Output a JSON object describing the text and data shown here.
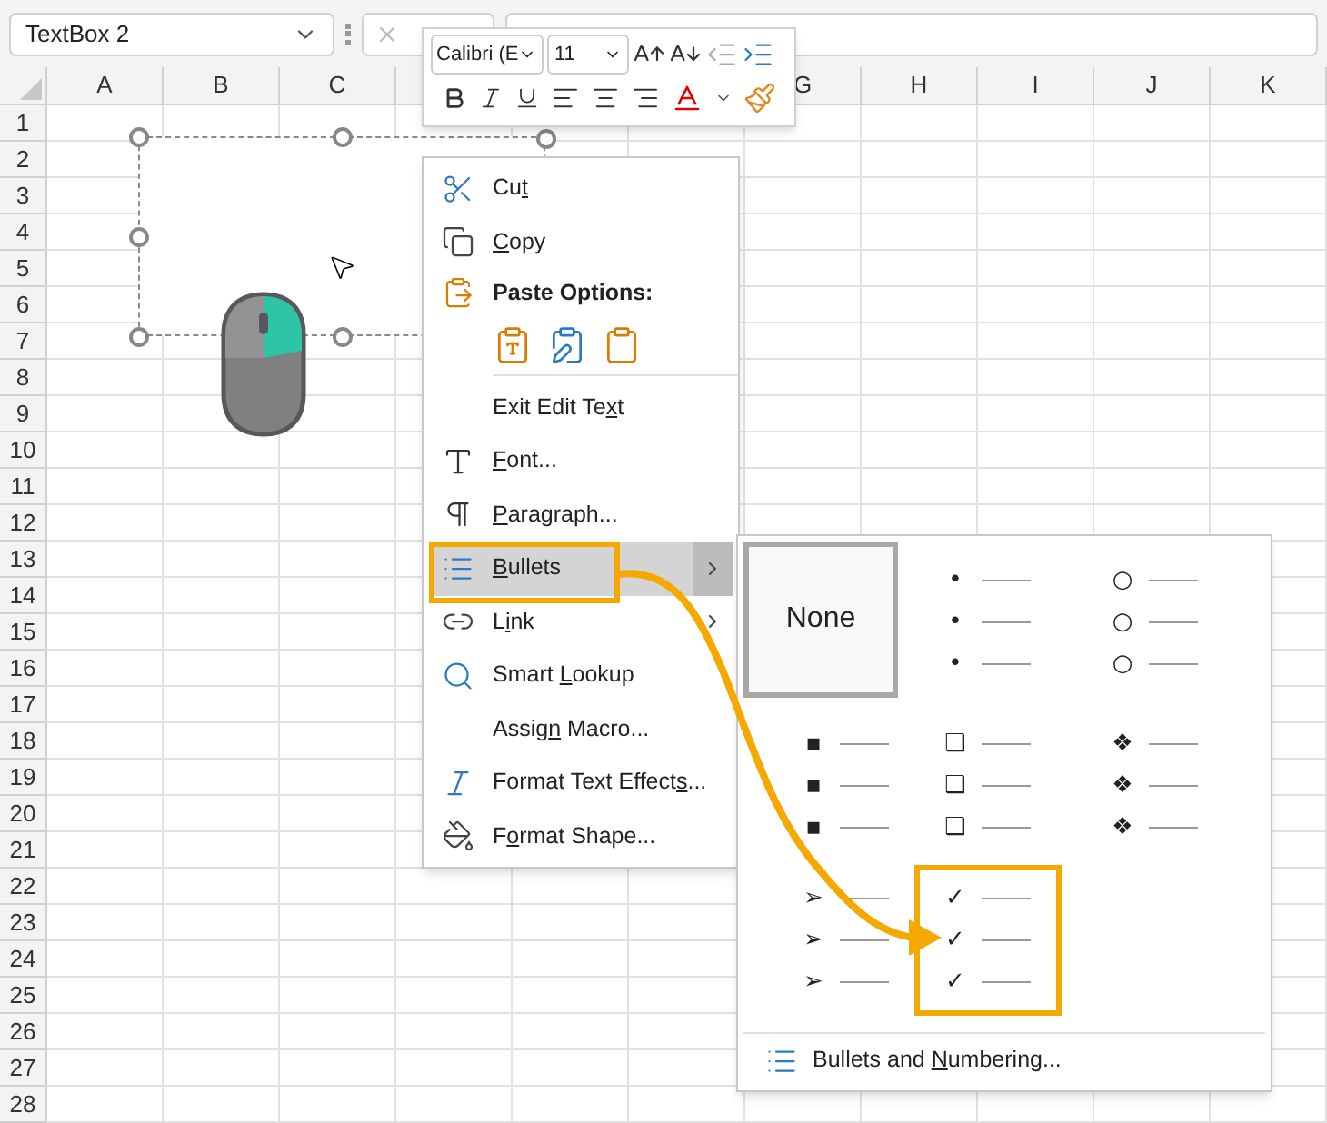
{
  "name_box": {
    "value": "TextBox 2"
  },
  "mini_toolbar": {
    "font_name": "Calibri (E",
    "font_size": "11"
  },
  "column_headers_left": [
    "A",
    "B",
    "C"
  ],
  "column_headers_right": [
    "G",
    "H",
    "I",
    "J",
    "K"
  ],
  "row_headers": [
    "1",
    "2",
    "3",
    "4",
    "5",
    "6",
    "7",
    "8",
    "9",
    "10",
    "11",
    "12",
    "13",
    "14",
    "15",
    "16",
    "17",
    "18",
    "19",
    "20",
    "21",
    "22",
    "23",
    "24",
    "25",
    "26",
    "27",
    "28"
  ],
  "context_menu": [
    {
      "kind": "item",
      "label": {
        "before": "Cu",
        "key": "t"
      },
      "selected": false,
      "submenu": false,
      "outlined": false
    },
    {
      "kind": "item",
      "label": {
        "key": "C",
        "after": "opy"
      },
      "selected": false,
      "submenu": false,
      "outlined": false
    },
    {
      "kind": "header",
      "label": "Paste Options:"
    },
    {
      "kind": "paste_icons"
    },
    {
      "kind": "item",
      "label": {
        "before": "Exit Edit Te",
        "key": "x",
        "after": "t"
      },
      "selected": false,
      "submenu": false,
      "outlined": false
    },
    {
      "kind": "item",
      "label": {
        "key": "F",
        "after": "ont..."
      },
      "selected": false,
      "submenu": false,
      "outlined": false
    },
    {
      "kind": "item",
      "label": {
        "key": "P",
        "after": "aragraph..."
      },
      "selected": false,
      "submenu": false,
      "outlined": false
    },
    {
      "kind": "item",
      "label": {
        "key": "B",
        "after": "ullets"
      },
      "selected": true,
      "submenu": true,
      "outlined": true
    },
    {
      "kind": "item",
      "label": {
        "before": "L",
        "key": "i",
        "after": "nk"
      },
      "selected": false,
      "submenu": true,
      "outlined": false
    },
    {
      "kind": "item",
      "label": {
        "before": "Smart ",
        "key": "L",
        "after": "ookup"
      },
      "selected": false,
      "submenu": false,
      "outlined": false
    },
    {
      "kind": "item",
      "label": {
        "before": "Assig",
        "key": "n",
        "after": " Macro..."
      },
      "selected": false,
      "submenu": false,
      "outlined": false
    },
    {
      "kind": "item",
      "label": {
        "before": "Format Text Effect",
        "key": "s",
        "after": "..."
      },
      "selected": false,
      "submenu": false,
      "outlined": false
    },
    {
      "kind": "item",
      "label": {
        "before": "F",
        "key": "o",
        "after": "rmat Shape..."
      },
      "selected": false,
      "submenu": false,
      "outlined": false
    }
  ],
  "bullets_submenu": {
    "styles": [
      {
        "kind": "none",
        "label": "None",
        "selected": true,
        "outlined": false
      },
      {
        "kind": "symbol",
        "symbols": [
          "•",
          "•",
          "•"
        ],
        "selected": false,
        "outlined": false
      },
      {
        "kind": "symbol",
        "symbols": [
          "○",
          "○",
          "○"
        ],
        "selected": false,
        "outlined": false
      },
      {
        "kind": "symbol",
        "symbols": [
          "▪",
          "▪",
          "▪"
        ],
        "selected": false,
        "outlined": false
      },
      {
        "kind": "symbol",
        "symbols": [
          "❑",
          "❑",
          "❑"
        ],
        "selected": false,
        "outlined": false
      },
      {
        "kind": "symbol",
        "symbols": [
          "❖",
          "❖",
          "❖"
        ],
        "selected": false,
        "outlined": false
      },
      {
        "kind": "symbol",
        "symbols": [
          "➢",
          "➢",
          "➢"
        ],
        "selected": false,
        "outlined": false
      },
      {
        "kind": "symbol",
        "symbols": [
          "✓",
          "✓",
          "✓"
        ],
        "selected": false,
        "outlined": true
      }
    ],
    "footer": {
      "before": "Bullets and ",
      "key": "N",
      "after": "umbering..."
    }
  },
  "callout_arrow": true
}
